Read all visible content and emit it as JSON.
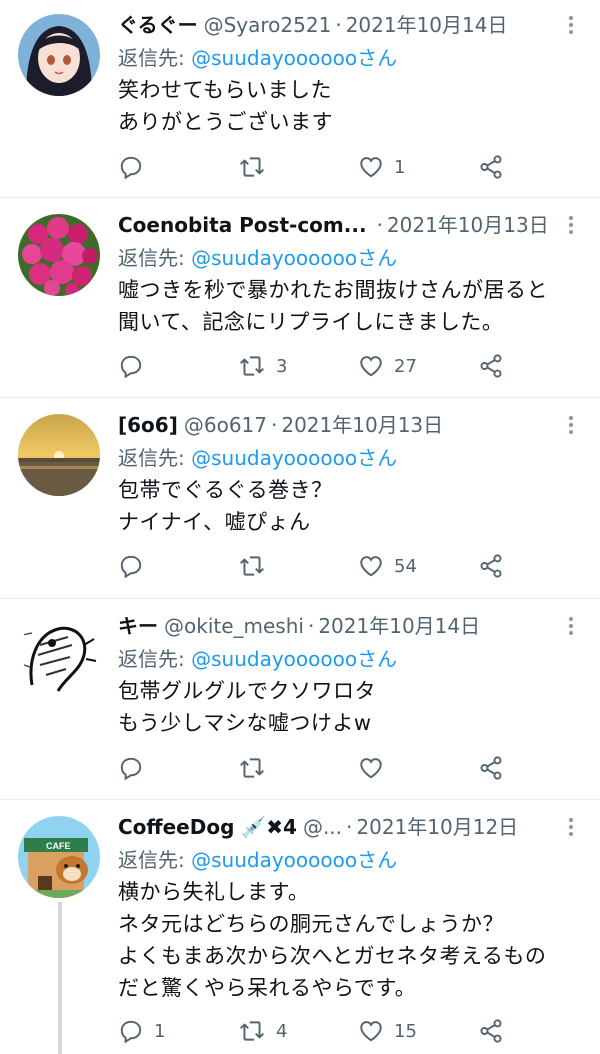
{
  "tweets": [
    {
      "name": "ぐるぐー",
      "handle": "@Syaro2521",
      "date": "2021年10月14日",
      "reply_label": "返信先:",
      "reply_to": "@suudayoooooo",
      "reply_suffix": "さん",
      "text": "笑わせてもらいました\nありがとうございます",
      "replies": "",
      "retweets": "",
      "likes": "1"
    },
    {
      "name": "Coenobita Post-com...",
      "handle": "",
      "date": "2021年10月13日",
      "reply_label": "返信先:",
      "reply_to": "@suudayoooooo",
      "reply_suffix": "さん",
      "text": "嘘つきを秒で暴かれたお間抜けさんが居ると\n聞いて、記念にリプライしにきました。",
      "replies": "",
      "retweets": "3",
      "likes": "27"
    },
    {
      "name": "[6o6]",
      "handle": "@6o617",
      "date": "2021年10月13日",
      "reply_label": "返信先:",
      "reply_to": "@suudayoooooo",
      "reply_suffix": "さん",
      "text": "包帯でぐるぐる巻き？\nナイナイ、嘘ぴょん",
      "replies": "",
      "retweets": "",
      "likes": "54"
    },
    {
      "name": "キー",
      "handle": "@okite_meshi",
      "date": "2021年10月14日",
      "reply_label": "返信先:",
      "reply_to": "@suudayoooooo",
      "reply_suffix": "さん",
      "text": "包帯グルグルでクソワロタ\nもう少しマシな嘘つけよw",
      "replies": "",
      "retweets": "",
      "likes": ""
    },
    {
      "name": "CoffeeDog 💉✖4",
      "handle": "@...",
      "date": "2021年10月12日",
      "reply_label": "返信先:",
      "reply_to": "@suudayoooooo",
      "reply_suffix": "さん",
      "text": "横から失礼します。\nネタ元はどちらの胴元さんでしょうか？\nよくもまあ次から次へとガセネタ考えるもの\nだと驚くやら呆れるやらです。",
      "replies": "1",
      "retweets": "4",
      "likes": "15"
    }
  ],
  "colors": {
    "link": "#1d9bf0",
    "muted": "#536471",
    "divider": "#e6ecf0"
  },
  "icons": [
    "reply-icon",
    "retweet-icon",
    "like-icon",
    "share-icon",
    "more-icon"
  ]
}
